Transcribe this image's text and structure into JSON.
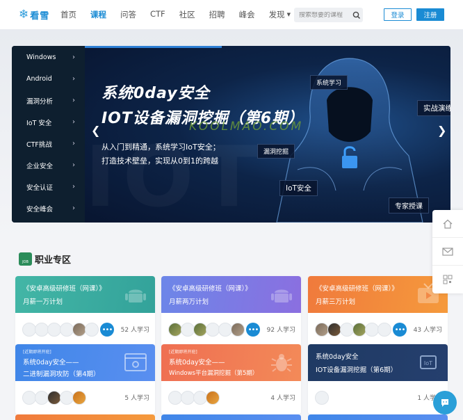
{
  "header": {
    "logo_text": "看雪",
    "nav": [
      {
        "label": "首页",
        "active": false
      },
      {
        "label": "课程",
        "active": true
      },
      {
        "label": "问答",
        "active": false
      },
      {
        "label": "CTF",
        "active": false
      },
      {
        "label": "社区",
        "active": false
      },
      {
        "label": "招聘",
        "active": false
      },
      {
        "label": "峰会",
        "active": false
      },
      {
        "label": "发现",
        "active": false
      }
    ],
    "search_placeholder": "搜索想要的课程",
    "login_label": "登录",
    "register_label": "注册"
  },
  "banner": {
    "menu": [
      "Windows",
      "Android",
      "漏洞分析",
      "IoT 安全",
      "CTF挑战",
      "企业安全",
      "安全认证",
      "安全峰会"
    ],
    "title_line1": "系统0day安全",
    "title_line2": "IOT设备漏洞挖掘（第6期）",
    "watermark": "KOOLMAO.COM",
    "subtitle_line1": "从入门到精通，系统学习IoT安全；",
    "subtitle_line2": "打造技术壁垒，实现从0到1的跨越",
    "tags": [
      "系统学习",
      "实战演练",
      "漏洞挖掘",
      "IoT安全",
      "专家授课"
    ],
    "bg_text": "IOT",
    "accent": "#2d7fd4"
  },
  "section": {
    "title": "职业专区",
    "icon_text": "JOB"
  },
  "cards": [
    {
      "badge": "",
      "line1": "《安卓高级研修班（网课）》",
      "line2": "月薪一万计划",
      "learners": "52 人学习",
      "more": "•••",
      "theme": "teal",
      "icon": "android-icon"
    },
    {
      "badge": "",
      "line1": "《安卓高级研修班（网课）》",
      "line2": "月薪两万计划",
      "learners": "92 人学习",
      "more": "•••",
      "theme": "purple",
      "icon": "android-icon"
    },
    {
      "badge": "",
      "line1": "《安卓高级研修班（网课）》",
      "line2": "月薪三万计划",
      "learners": "43 人学习",
      "more": "•••",
      "theme": "orange",
      "icon": "tv-icon"
    },
    {
      "badge": "[近期即将开班]",
      "line1": "系统0day安全——",
      "line2": "二进制漏洞攻防（第4期）",
      "learners": "5 人学习",
      "theme": "blue",
      "icon": "browser-icon"
    },
    {
      "badge": "[近期即将开班]",
      "line1": "系统0day安全——",
      "line2": "Windows平台漏洞挖掘（第5期）",
      "learners": "4 人学习",
      "theme": "coral",
      "icon": "bug-icon"
    },
    {
      "badge": "",
      "line1": "系统0day安全",
      "line2": "IOT设备漏洞挖掘（第6期）",
      "learners": "1 人学习",
      "theme": "navy",
      "icon": "iot-chip-icon"
    }
  ]
}
